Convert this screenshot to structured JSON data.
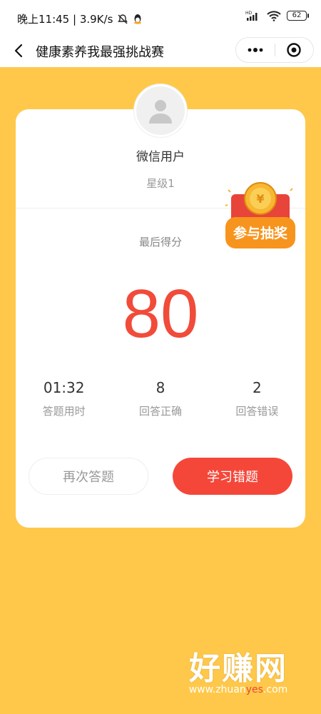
{
  "status_bar": {
    "time_speed": "晚上11:45 | 3.9K/s",
    "battery": "62"
  },
  "nav": {
    "title": "健康素养我最强挑战赛"
  },
  "user": {
    "name": "微信用户",
    "level": "星级1"
  },
  "result": {
    "score_label": "最后得分",
    "score": "80",
    "stats": [
      {
        "value": "01:32",
        "label": "答题用时"
      },
      {
        "value": "8",
        "label": "回答正确"
      },
      {
        "value": "2",
        "label": "回答错误"
      }
    ]
  },
  "buttons": {
    "retry": "再次答题",
    "study": "学习错题"
  },
  "lottery": {
    "label": "参与抽奖"
  },
  "watermark": {
    "main": "好赚网",
    "sub_a": "www.zhuan",
    "sub_b": "yes",
    "sub_c": ".com"
  },
  "colors": {
    "background": "#ffc84a",
    "score": "#f14b3a",
    "primary_button": "#f4473a"
  }
}
